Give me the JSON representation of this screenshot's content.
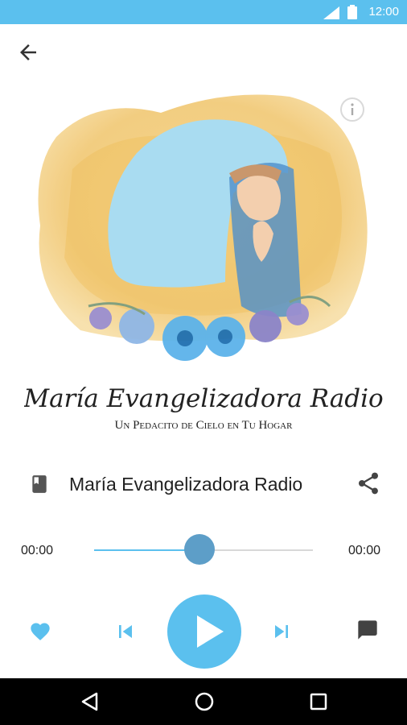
{
  "status_bar": {
    "time": "12:00"
  },
  "artwork": {
    "logo_title": "María Evangelizadora Radio",
    "logo_subtitle": "Un Pedacito de Cielo en Tu Hogar"
  },
  "station": {
    "title": "María Evangelizadora Radio"
  },
  "player": {
    "elapsed": "00:00",
    "duration": "00:00",
    "progress_percent": 48
  },
  "colors": {
    "accent": "#5bc0ee",
    "thumb": "#5d9ec8",
    "icon_dark": "#424242"
  },
  "icons": {
    "back": "arrow-back-icon",
    "info": "info-icon",
    "book": "book-icon",
    "share": "share-icon",
    "favorite": "heart-icon",
    "previous": "skip-previous-icon",
    "play": "play-icon",
    "next": "skip-next-icon",
    "chat": "chat-icon"
  }
}
